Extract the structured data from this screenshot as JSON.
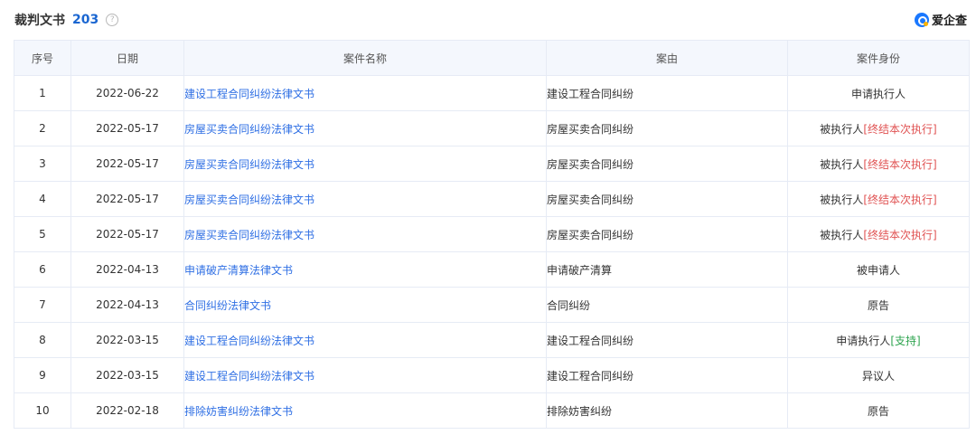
{
  "header": {
    "title": "裁判文书",
    "count": "203",
    "help_icon": "question-circle-icon",
    "brand_name": "爱企查",
    "brand_icon": "aiqicha-logo-icon"
  },
  "colors": {
    "accent": "#1a66d1",
    "link": "#2f6fe4",
    "red": "#e05252",
    "green": "#2ea44f",
    "header_bg": "#f4f7fd"
  },
  "table": {
    "columns": [
      "序号",
      "日期",
      "案件名称",
      "案由",
      "案件身份"
    ],
    "rows": [
      {
        "no": "1",
        "date": "2022-06-22",
        "name": "建设工程合同纠纷法律文书",
        "reason": "建设工程合同纠纷",
        "role": "申请执行人",
        "tag": ""
      },
      {
        "no": "2",
        "date": "2022-05-17",
        "name": "房屋买卖合同纠纷法律文书",
        "reason": "房屋买卖合同纠纷",
        "role": "被执行人",
        "tag": "[终结本次执行]"
      },
      {
        "no": "3",
        "date": "2022-05-17",
        "name": "房屋买卖合同纠纷法律文书",
        "reason": "房屋买卖合同纠纷",
        "role": "被执行人",
        "tag": "[终结本次执行]"
      },
      {
        "no": "4",
        "date": "2022-05-17",
        "name": "房屋买卖合同纠纷法律文书",
        "reason": "房屋买卖合同纠纷",
        "role": "被执行人",
        "tag": "[终结本次执行]"
      },
      {
        "no": "5",
        "date": "2022-05-17",
        "name": "房屋买卖合同纠纷法律文书",
        "reason": "房屋买卖合同纠纷",
        "role": "被执行人",
        "tag": "[终结本次执行]"
      },
      {
        "no": "6",
        "date": "2022-04-13",
        "name": "申请破产清算法律文书",
        "reason": "申请破产清算",
        "role": "被申请人",
        "tag": ""
      },
      {
        "no": "7",
        "date": "2022-04-13",
        "name": "合同纠纷法律文书",
        "reason": "合同纠纷",
        "role": "原告",
        "tag": ""
      },
      {
        "no": "8",
        "date": "2022-03-15",
        "name": "建设工程合同纠纷法律文书",
        "reason": "建设工程合同纠纷",
        "role": "申请执行人",
        "tag": "[支持]"
      },
      {
        "no": "9",
        "date": "2022-03-15",
        "name": "建设工程合同纠纷法律文书",
        "reason": "建设工程合同纠纷",
        "role": "异议人",
        "tag": ""
      },
      {
        "no": "10",
        "date": "2022-02-18",
        "name": "排除妨害纠纷法律文书",
        "reason": "排除妨害纠纷",
        "role": "原告",
        "tag": ""
      }
    ]
  }
}
